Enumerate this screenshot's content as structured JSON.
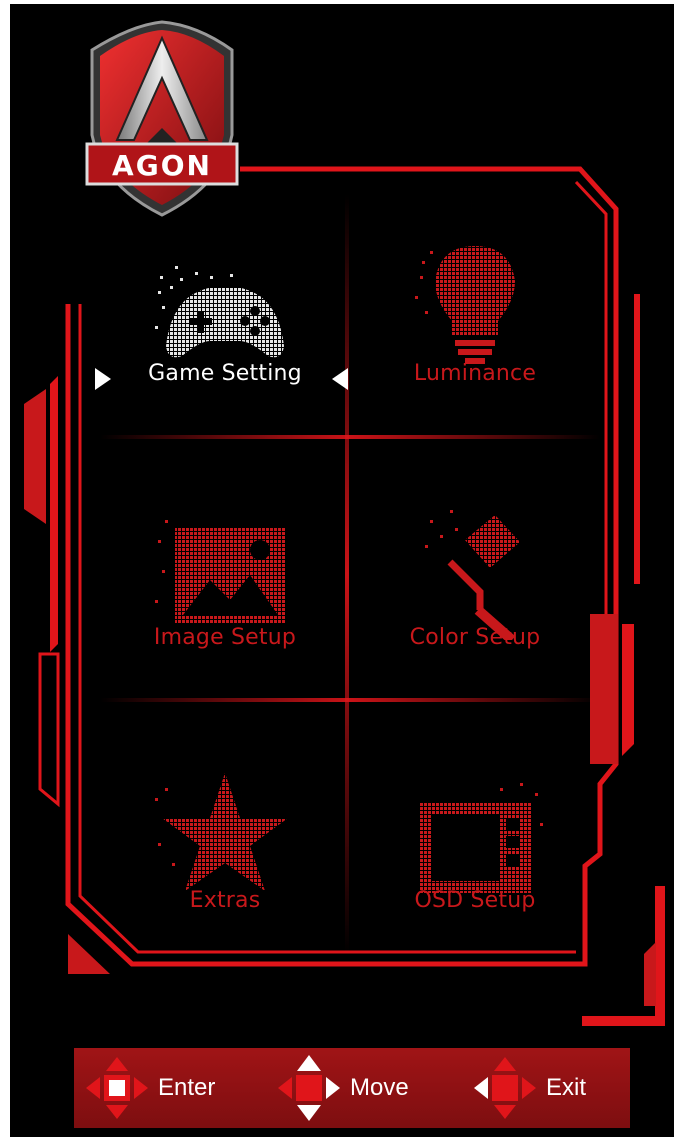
{
  "brand": {
    "logo_text": "AGON"
  },
  "menu": [
    {
      "label": "Game Setting",
      "active": true,
      "icon": "gamepad-icon"
    },
    {
      "label": "Luminance",
      "active": false,
      "icon": "lightbulb-icon"
    },
    {
      "label": "Image Setup",
      "active": false,
      "icon": "picture-icon"
    },
    {
      "label": "Color Setup",
      "active": false,
      "icon": "paint-roller-icon"
    },
    {
      "label": "Extras",
      "active": false,
      "icon": "star-icon"
    },
    {
      "label": "OSD Setup",
      "active": false,
      "icon": "osd-panel-icon"
    }
  ],
  "footer": {
    "enter_label": "Enter",
    "move_label": "Move",
    "exit_label": "Exit"
  },
  "colors": {
    "accent": "#e0151a",
    "dark_red": "#7a0d10",
    "background": "#000000",
    "active_text": "#ffffff"
  }
}
